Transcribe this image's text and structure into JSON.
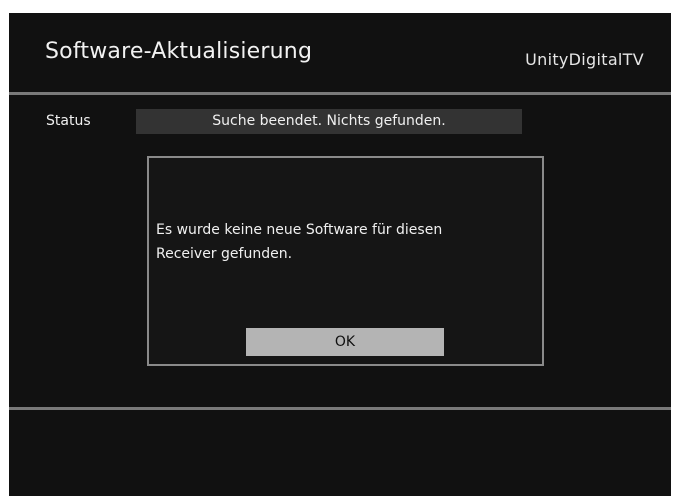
{
  "header": {
    "title": "Software-Aktualisierung",
    "brand": "UnityDigitalTV"
  },
  "status": {
    "label": "Status",
    "value": "Suche beendet. Nichts gefunden."
  },
  "dialog": {
    "message_line1": "Es wurde keine neue Software für diesen",
    "message_line2": "Receiver gefunden.",
    "ok_label": "OK"
  },
  "colors": {
    "screen_background": "#111111",
    "divider": "#7a7a7a",
    "status_field": "#333333",
    "dialog_border": "#8a8a8a",
    "button_focused": "#b4b4b4",
    "text": "#f0f0f0"
  }
}
